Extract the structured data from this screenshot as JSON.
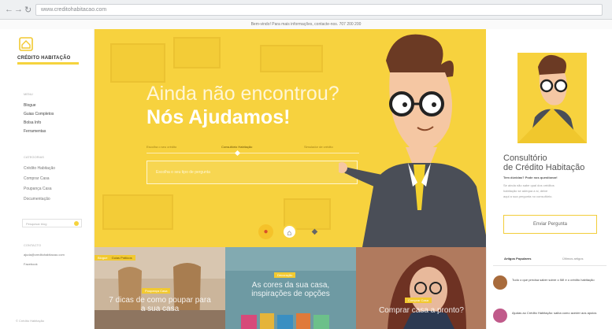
{
  "browser": {
    "url": "www.creditohabitacao.com",
    "notice": "Bem-vindo! Para mais informações, contacte-nos. 707 200 200"
  },
  "sidebar": {
    "brand": "CRÉDITO HABITAÇÃO",
    "section1_head": "Menu",
    "links1": [
      "Blogue",
      "Guias Completos",
      "Bolsa Info",
      "Ferramentas"
    ],
    "section2_head": "Categorias",
    "links2": [
      "Crédito Habitação",
      "Comprar Casa",
      "Poupança Casa",
      "Documentação"
    ],
    "search_placeholder": "Pesquisar blog",
    "section3_head": "Contacto",
    "contact": "ajuda@creditohabitacao.com",
    "contact2": "Facebook",
    "footer": "© Crédito Habitação"
  },
  "hero": {
    "title_line1": "Ainda não encontrou?",
    "title_line2": "Nós Ajudamos!",
    "tabs": [
      "Escolha o seu crédito",
      "Consultório Habitação",
      "Simulador de crédito"
    ],
    "select_placeholder": "Escolha o seu tipo de pergunta",
    "accent": "#f7d23e"
  },
  "consultorio": {
    "title_line1": "Consultório",
    "title_line2": "de Crédito Habitação",
    "subtitle": "Tem dúvidas? Pode nos questionar!",
    "text_lines": [
      "Se ainda não sabe qual dos créditos",
      "habitação se adequa a si, deixe",
      "aqui a sua pergunta no consultório."
    ],
    "button": "Enviar Pergunta"
  },
  "cards": [
    {
      "label": "Blogue",
      "tag": "Guias Práticos",
      "category": "Poupança Casa",
      "text": "7 dicas de como poupar para a sua casa"
    },
    {
      "label": "",
      "tag": "",
      "category": "Decoração",
      "text": "As cores da sua casa, inspirações de opções"
    },
    {
      "label": "",
      "tag": "",
      "category": "Comprar Casa",
      "text": "Comprar casa a pronto?"
    }
  ],
  "rightbottom": {
    "tabs": [
      "Artigos Populares",
      "Últimos artigos"
    ],
    "items": [
      "Tudo o que precisa saber sobre o IMI e o crédito habitação",
      "Ajudas ao Crédito Habitação: saiba como aceder aos apoios"
    ]
  }
}
